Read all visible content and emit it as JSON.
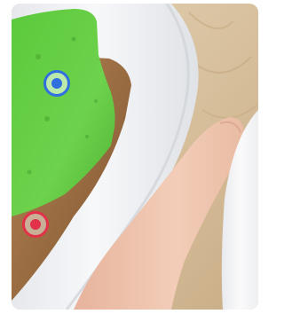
{
  "photo": {
    "subject_icon": "photo-green-cake-on-plate",
    "colors": {
      "table": "#d9c4a3",
      "plate": "#f2f3f5",
      "cake": "#6ccf4c",
      "crust": "#9a6a3a",
      "skin": "#efc3ad",
      "cup": "#f7f7f8"
    }
  },
  "markers": [
    {
      "id": "blue",
      "color": "#2f6fe0"
    },
    {
      "id": "red",
      "color": "#e2324a"
    }
  ]
}
